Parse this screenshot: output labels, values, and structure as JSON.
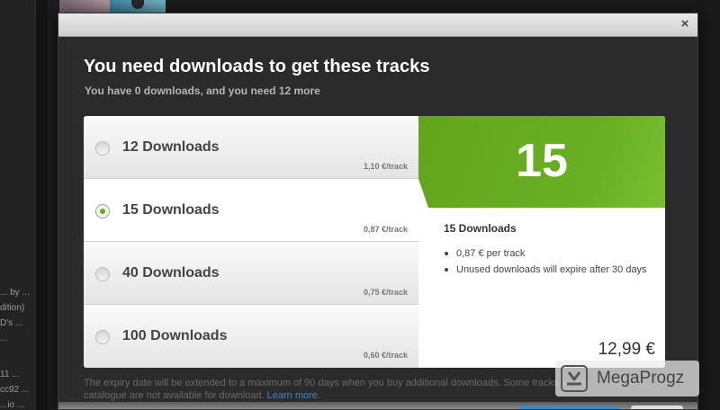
{
  "background": {
    "side_texts": [
      "... by ...",
      "dition)",
      "D's ...",
      "...",
      "11 ...",
      "cc92 ...",
      "...io ..."
    ]
  },
  "modal": {
    "close_label": "×",
    "title": "You need downloads to get these tracks",
    "subtitle": "You have 0 downloads, and you need 12 more",
    "options": [
      {
        "label": "12 Downloads",
        "price": "1,10 €/track",
        "selected": false
      },
      {
        "label": "15 Downloads",
        "price": "0,87 €/track",
        "selected": true
      },
      {
        "label": "40 Downloads",
        "price": "0,75 €/track",
        "selected": false
      },
      {
        "label": "100 Downloads",
        "price": "0,60 €/track",
        "selected": false
      }
    ],
    "summary": {
      "count": "15",
      "title": "15 Downloads",
      "bullets": [
        "0,87 € per track",
        "Unused downloads will expire after 30 days"
      ],
      "price": "12,99 €"
    },
    "footer_note": "The expiry date will be extended to a maximum of 90 days when you buy additional downloads. Some tracks in our catalogue are not available for download.",
    "learn_more": "Learn more."
  },
  "watermark": {
    "text": "MegaProgz",
    "icon": "download-icon"
  },
  "colors": {
    "accent_green": "#6aab1c",
    "link_blue": "#3a8ac4",
    "modal_bg": "#2b2b2b"
  }
}
